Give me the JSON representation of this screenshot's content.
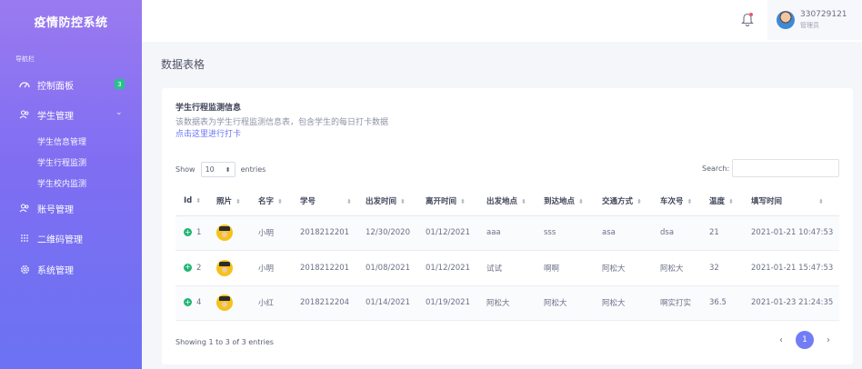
{
  "sidebar": {
    "brand": "疫情防控系统",
    "caption": "导航栏",
    "items": [
      {
        "label": "控制面板",
        "icon": "dashboard-icon",
        "badge": "3"
      },
      {
        "label": "学生管理",
        "icon": "users-icon",
        "chevron": "chevron-down-icon"
      },
      {
        "label": "账号管理",
        "icon": "account-icon"
      },
      {
        "label": "二维码管理",
        "icon": "grid-icon"
      },
      {
        "label": "系统管理",
        "icon": "gear-icon"
      }
    ],
    "subitems": [
      "学生信息管理",
      "学生行程监测",
      "学生校内监测"
    ]
  },
  "header": {
    "bell_icon": "bell-icon",
    "user_name": "330729121",
    "user_role": "管理员"
  },
  "page_title": "数据表格",
  "card": {
    "title": "学生行程监测信息",
    "description": "该数据表为学生行程监测信息表，包含学生的每日打卡数据",
    "link": "点击这里进行打卡",
    "show_label": "Show",
    "page_length": "10",
    "entries_label": "entries",
    "search_label": "Search:",
    "search_value": ""
  },
  "table": {
    "columns": [
      "Id",
      "照片",
      "名字",
      "学号",
      "出发时间",
      "离开时间",
      "出发地点",
      "到达地点",
      "交通方式",
      "车次号",
      "温度",
      "填写时间"
    ],
    "rows": [
      {
        "id": "1",
        "name": "小明",
        "student_no": "2018212201",
        "depart_time": "12/30/2020",
        "leave_time": "01/12/2021",
        "from": "aaa",
        "to": "sss",
        "transport": "asa",
        "train_no": "dsa",
        "temp": "21",
        "filled_at": "2021-01-21 10:47:53"
      },
      {
        "id": "2",
        "name": "小明",
        "student_no": "2018212201",
        "depart_time": "01/08/2021",
        "leave_time": "01/12/2021",
        "from": "试试",
        "to": "啊啊",
        "transport": "阿松大",
        "train_no": "阿松大",
        "temp": "32",
        "filled_at": "2021-01-21 15:47:53"
      },
      {
        "id": "4",
        "name": "小红",
        "student_no": "2018212204",
        "depart_time": "01/14/2021",
        "leave_time": "01/19/2021",
        "from": "阿松大",
        "to": "阿松大",
        "transport": "阿松大",
        "train_no": "啊实打实",
        "temp": "36.5",
        "filled_at": "2021-01-23 21:24:35"
      }
    ]
  },
  "footer": {
    "info": "Showing 1 to 3 of 3 entries",
    "current_page": "1",
    "prev": "‹",
    "next": "›"
  }
}
